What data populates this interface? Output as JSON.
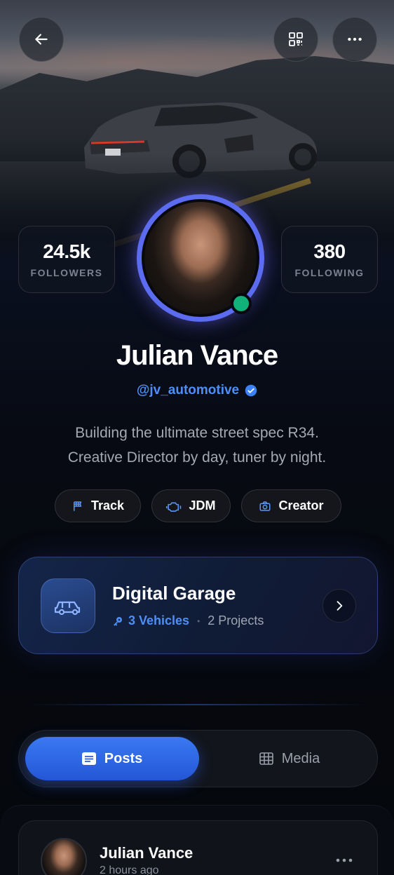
{
  "profile": {
    "name": "Julian Vance",
    "handle": "@jv_automotive",
    "bio_line1": "Building the ultimate street spec R34.",
    "bio_line2": "Creative Director by day, tuner by night."
  },
  "stats": {
    "followers": {
      "value": "24.5k",
      "label": "FOLLOWERS"
    },
    "following": {
      "value": "380",
      "label": "FOLLOWING"
    }
  },
  "tags": [
    {
      "label": "Track",
      "icon": "flag-icon"
    },
    {
      "label": "JDM",
      "icon": "engine-icon"
    },
    {
      "label": "Creator",
      "icon": "camera-icon"
    }
  ],
  "garage": {
    "title": "Digital Garage",
    "vehicles": "3 Vehicles",
    "separator": "•",
    "projects": "2 Projects"
  },
  "tabs": [
    {
      "label": "Posts",
      "icon": "list-icon",
      "active": true
    },
    {
      "label": "Media",
      "icon": "grid-icon",
      "active": false
    }
  ],
  "post": {
    "author": "Julian Vance",
    "time": "2 hours ago"
  },
  "colors": {
    "accent": "#3a79f2",
    "handle": "#4e8ff7",
    "online": "#10b27a",
    "ring": "#6a66f4"
  }
}
